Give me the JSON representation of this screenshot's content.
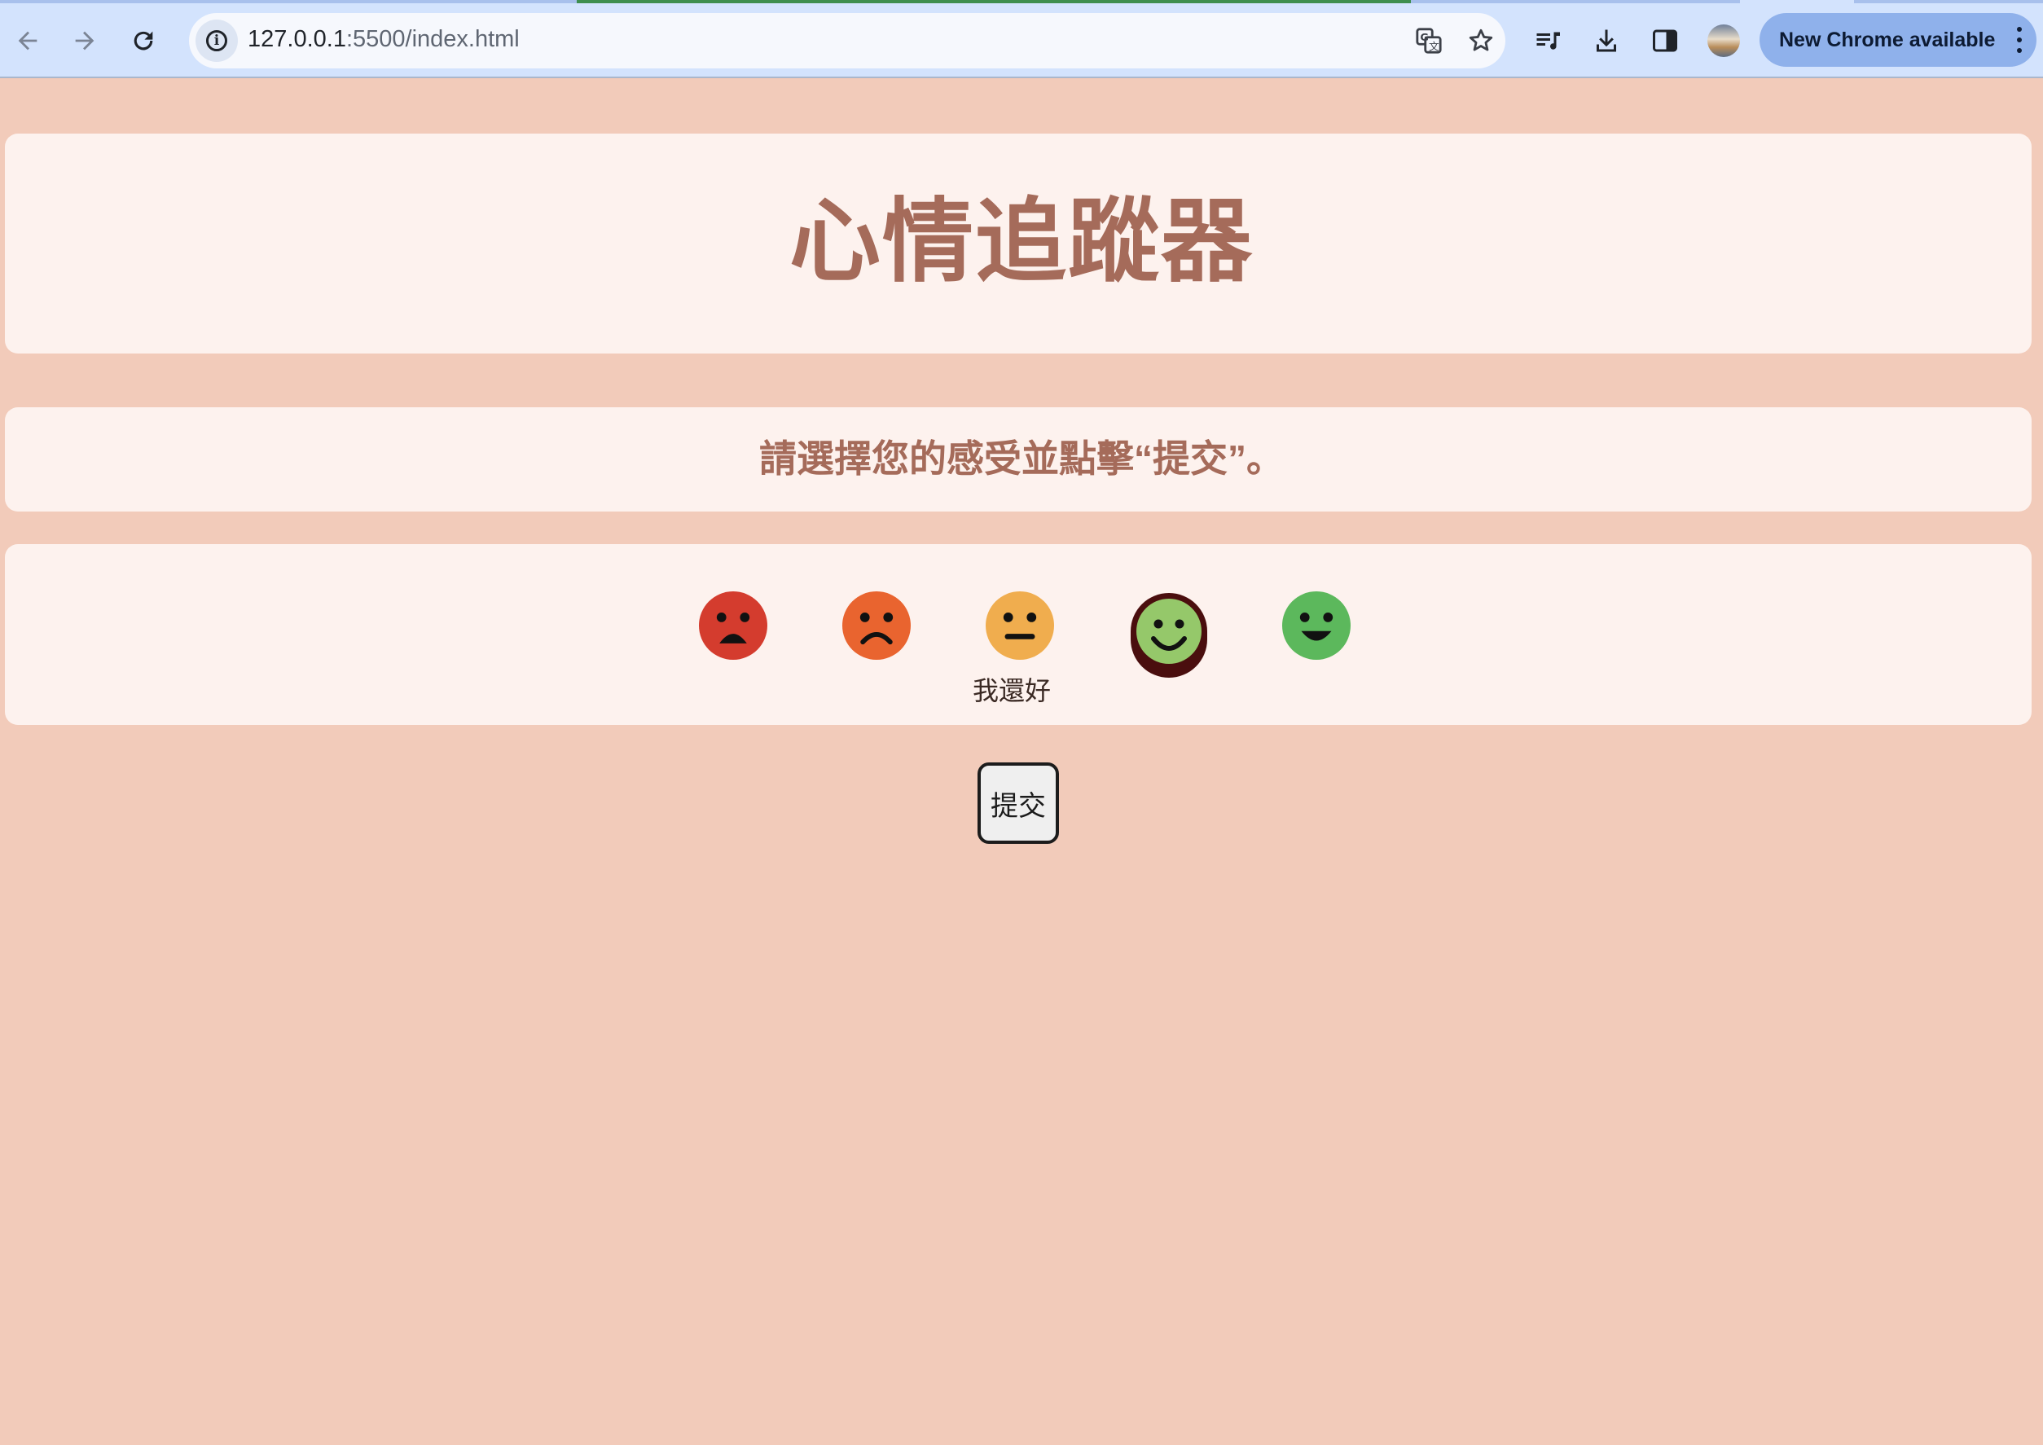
{
  "browser": {
    "url_host": "127.0.0.1",
    "url_path": ":5500/index.html",
    "update_button_label": "New Chrome available"
  },
  "page": {
    "title": "心情追蹤器",
    "prompt": "請選擇您的感受並點擊“提交”。",
    "hovered_mood_label": "我還好",
    "submit_label": "提交"
  },
  "moods": [
    {
      "name": "very-sad",
      "color": "#d43c2e"
    },
    {
      "name": "sad",
      "color": "#e9642f"
    },
    {
      "name": "neutral",
      "color": "#f0ad4e"
    },
    {
      "name": "happy",
      "color": "#95c86a",
      "selected": true
    },
    {
      "name": "very-happy",
      "color": "#5cb85c"
    }
  ],
  "colors": {
    "background": "#f2cbba",
    "card": "#fdf2ee",
    "accent_text": "#a56b5a",
    "selected_ring": "#4a0e0e"
  }
}
